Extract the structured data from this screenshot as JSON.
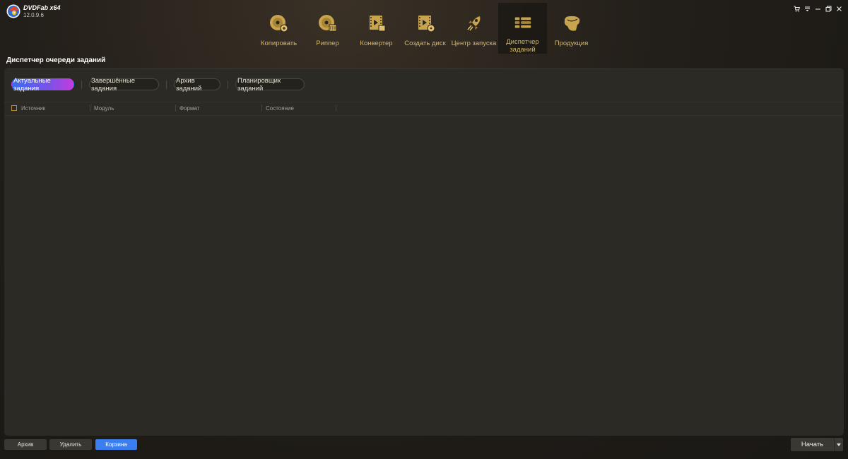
{
  "app": {
    "name": "DVDFab x64",
    "version": "12.0.9.6"
  },
  "window_controls": [
    {
      "name": "cart-icon"
    },
    {
      "name": "menu-icon"
    },
    {
      "name": "minimize-icon"
    },
    {
      "name": "restore-icon"
    },
    {
      "name": "close-icon"
    }
  ],
  "nav": [
    {
      "label": "Копировать",
      "icon": "disc-copy-icon"
    },
    {
      "label": "Риппер",
      "icon": "disc-ripper-icon"
    },
    {
      "label": "Конвертер",
      "icon": "film-converter-icon"
    },
    {
      "label": "Создать диск",
      "icon": "film-creator-icon"
    },
    {
      "label": "Центр запуска",
      "icon": "rocket-icon"
    },
    {
      "label": "Диспетчер заданий",
      "icon": "task-list-icon",
      "active": true
    },
    {
      "label": "Продукция",
      "icon": "products-icon"
    }
  ],
  "page_title": "Диспетчер очереди заданий",
  "tabs": [
    {
      "label": "Актуальные задания",
      "active": true
    },
    {
      "label": "Завершённые задания"
    },
    {
      "label": "Архив заданий"
    },
    {
      "label": "Планировщик заданий"
    }
  ],
  "columns": [
    "Источник",
    "Модуль",
    "Формат",
    "Состояние"
  ],
  "buttons": {
    "archive": "Архив",
    "delete": "Удалить",
    "trash": "Корзина",
    "start": "Начать"
  },
  "colors": {
    "accent_gold": "#d4b768",
    "primary_blue": "#3b7ef2",
    "panel_bg": "#2c2a24"
  }
}
